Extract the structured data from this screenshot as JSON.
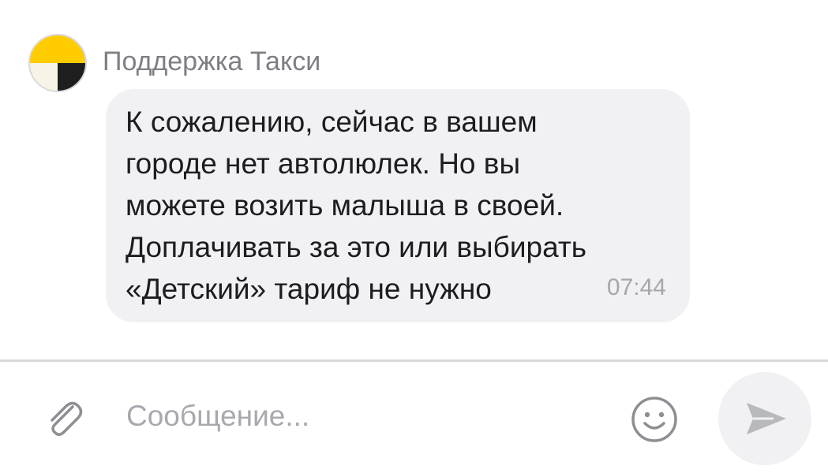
{
  "chat": {
    "sender_name": "Поддержка Такси",
    "message": {
      "lines": [
        "К сожалению, сейчас в вашем",
        "городе нет автолюлек. Но вы",
        "можете возить малыша в своей.",
        "Доплачивать за это или выбирать",
        "«Детский» тариф не нужно"
      ],
      "time": "07:44"
    }
  },
  "composer": {
    "placeholder": "Сообщение..."
  },
  "icons": {
    "attach": "paperclip-icon",
    "emoji": "smiley-icon",
    "send": "send-arrow-icon"
  },
  "colors": {
    "bubble": "#f1f1f3",
    "avatar_yellow": "#ffcc00",
    "avatar_black": "#1e1e1e",
    "muted_text": "#a6a7ac"
  }
}
